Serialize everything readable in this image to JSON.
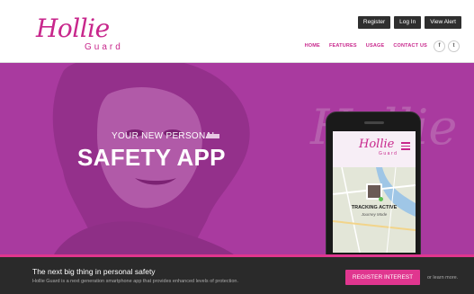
{
  "brand": {
    "logo_script": "Hollie",
    "logo_sub": "Guard",
    "primary_color": "#c8278c",
    "hero_color": "#a93a9f",
    "accent_pink": "#e0368f"
  },
  "top_buttons": {
    "register": "Register",
    "login": "Log In",
    "view_alert": "View Alert"
  },
  "nav": {
    "home": "HOME",
    "features": "FEATURES",
    "usage": "USAGE",
    "contact": "CONTACT US"
  },
  "social": {
    "facebook": "f",
    "twitter": "t"
  },
  "hero": {
    "tagline_small": "YOUR NEW PERSONAL",
    "tagline_big": "SAFETY APP",
    "ghost_logo": "Hollie"
  },
  "phone_app": {
    "logo_script": "Hollie",
    "logo_sub": "Guard",
    "status": "TRACKING ACTIVE",
    "mode": "Journey Mode"
  },
  "footer": {
    "title": "The next big thing in personal safety",
    "description": "Hollie Guard is a next generation smartphone app that provides enhanced levels of protection.",
    "cta": "REGISTER INTEREST",
    "learn_more": "or learn more."
  }
}
